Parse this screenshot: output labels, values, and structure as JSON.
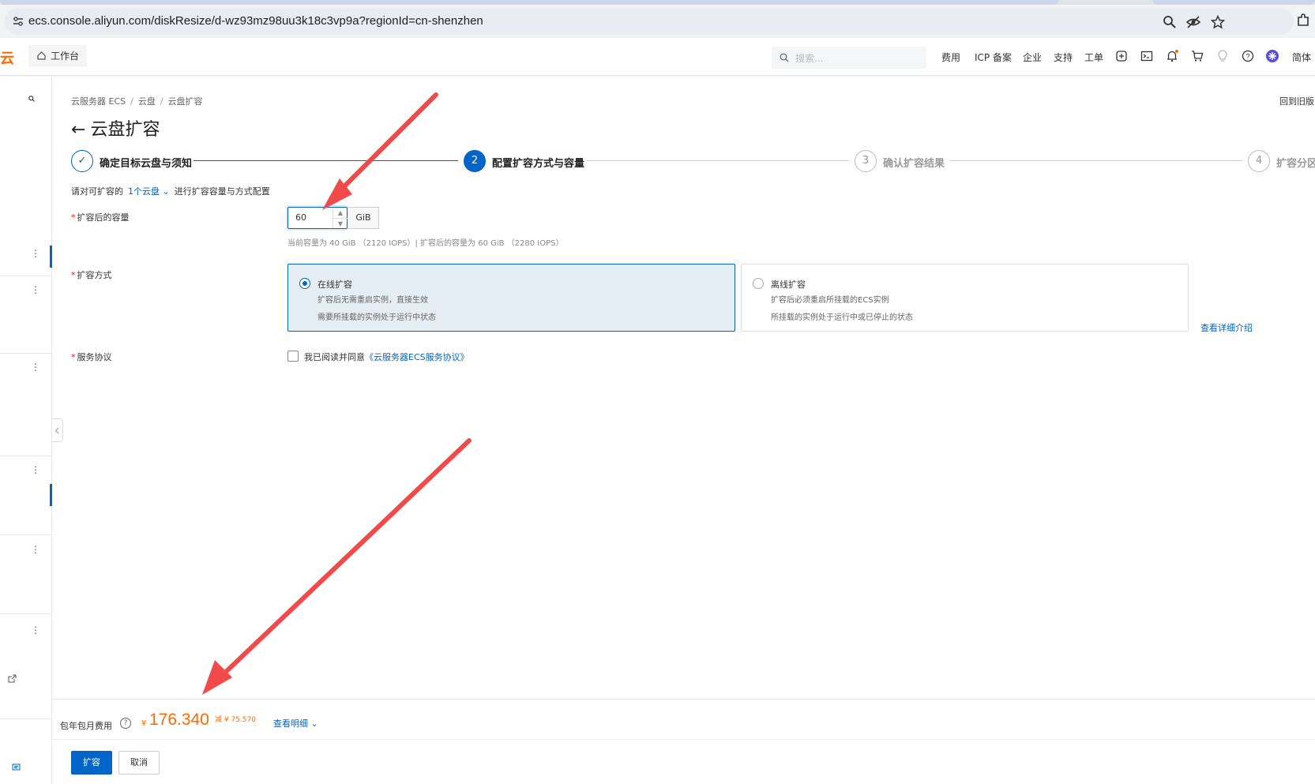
{
  "browser": {
    "url": "ecs.console.aliyun.com/diskResize/d-wz93mz98uu3k18c3vp9a?regionId=cn-shenzhen"
  },
  "topnav": {
    "logo_char": "云",
    "workbench": "工作台",
    "search_placeholder": "搜索...",
    "links": [
      "费用",
      "ICP 备案",
      "企业",
      "支持",
      "工单"
    ],
    "language": "简体"
  },
  "breadcrumb": [
    "云服务器 ECS",
    "云盘",
    "云盘扩容"
  ],
  "back_link": "回到旧版",
  "page_title": "云盘扩容",
  "steps": [
    {
      "num": "✓",
      "label": "确定目标云盘与须知",
      "state": "done"
    },
    {
      "num": "2",
      "label": "配置扩容方式与容量",
      "state": "active"
    },
    {
      "num": "3",
      "label": "确认扩容结果",
      "state": "pending"
    },
    {
      "num": "4",
      "label": "扩容分区",
      "state": "pending"
    }
  ],
  "instruction": {
    "prefix": "请对可扩容的",
    "link": "1个云盘",
    "suffix": "进行扩容容量与方式配置"
  },
  "capacity": {
    "label": "扩容后的容量",
    "value": "60",
    "unit": "GiB",
    "hint": "当前容量为 40 GiB （2120 IOPS）| 扩容后的容量为 60 GiB （2280 IOPS）"
  },
  "method": {
    "label": "扩容方式",
    "options": [
      {
        "title": "在线扩容",
        "desc1": "扩容后无需重启实例，直接生效",
        "desc2": "需要所挂载的实例处于运行中状态",
        "selected": true
      },
      {
        "title": "离线扩容",
        "desc1": "扩容后必须重启所挂载的ECS实例",
        "desc2": "所挂载的实例处于运行中或已停止的状态",
        "selected": false
      }
    ],
    "detail_link": "查看详细介绍"
  },
  "agreement": {
    "label": "服务协议",
    "text": "我已阅读并同意",
    "link": "《云服务器ECS服务协议》"
  },
  "fee": {
    "label": "包年包月费用",
    "currency": "¥",
    "price": "176.340",
    "discount": "减 ¥ 75.570",
    "detail": "查看明细"
  },
  "actions": {
    "submit": "扩容",
    "cancel": "取消"
  },
  "colors": {
    "primary": "#0064c8",
    "price": "#ff6a00",
    "annotation_arrow": "#f04a4a",
    "selected_card_bg": "#e5edf5"
  }
}
